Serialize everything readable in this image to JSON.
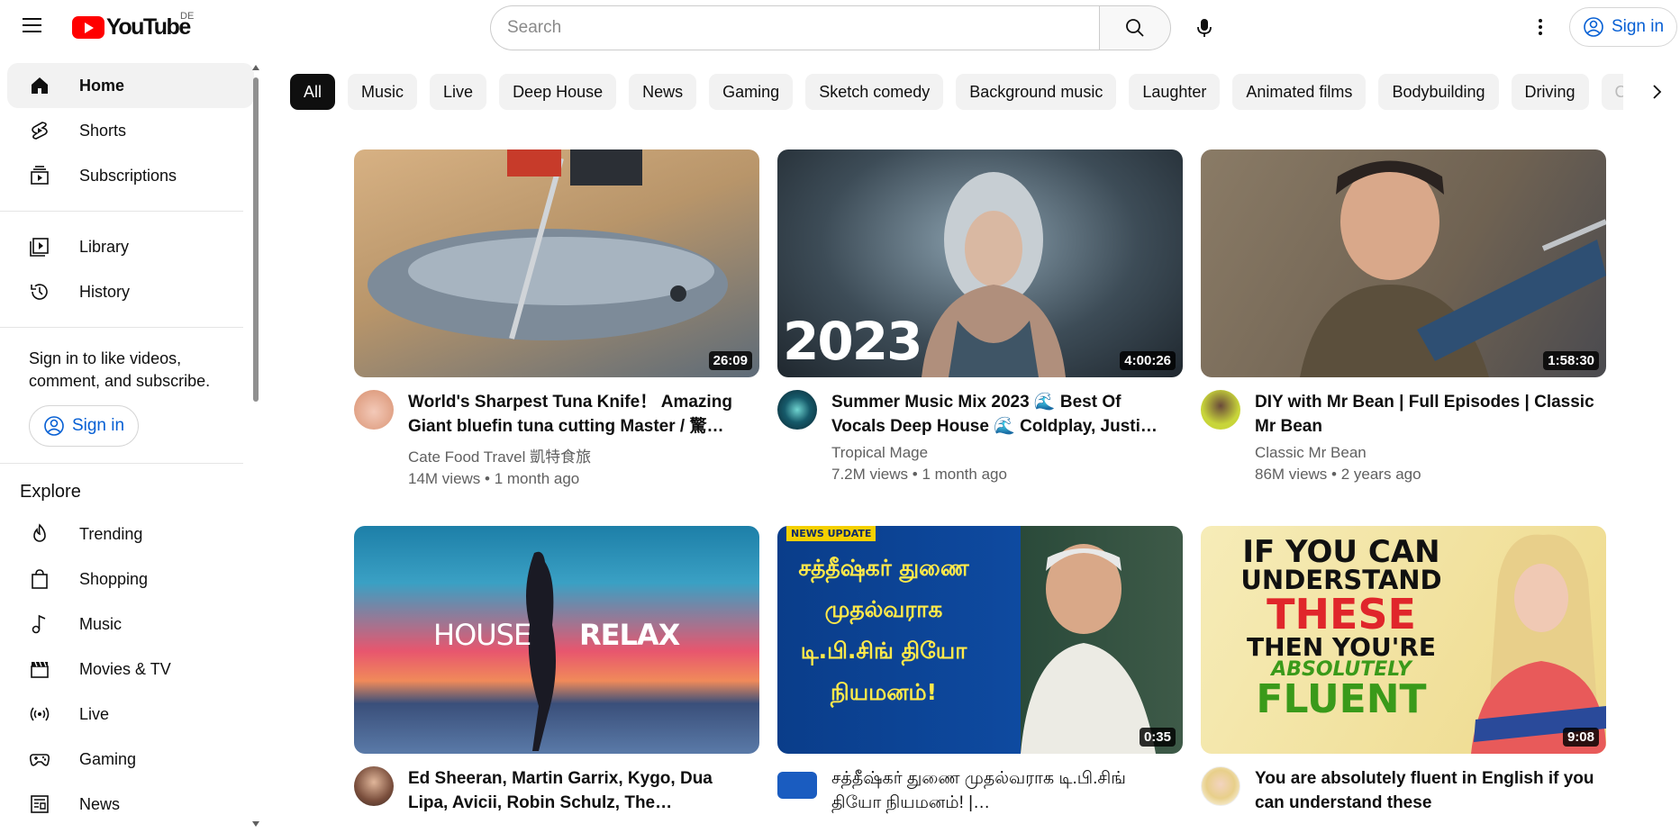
{
  "header": {
    "logo_text": "YouTube",
    "country": "DE",
    "search_placeholder": "Search",
    "signin_label": "Sign in"
  },
  "sidebar": {
    "primary": [
      {
        "label": "Home",
        "icon": "home-icon",
        "active": true
      },
      {
        "label": "Shorts",
        "icon": "shorts-icon"
      },
      {
        "label": "Subscriptions",
        "icon": "subscriptions-icon"
      }
    ],
    "library": [
      {
        "label": "Library",
        "icon": "library-icon"
      },
      {
        "label": "History",
        "icon": "history-icon"
      }
    ],
    "signin_prompt": "Sign in to like videos, comment, and subscribe.",
    "signin_label": "Sign in",
    "explore_title": "Explore",
    "explore": [
      {
        "label": "Trending",
        "icon": "trending-icon"
      },
      {
        "label": "Shopping",
        "icon": "shopping-icon"
      },
      {
        "label": "Music",
        "icon": "music-icon"
      },
      {
        "label": "Movies & TV",
        "icon": "movies-icon"
      },
      {
        "label": "Live",
        "icon": "live-icon"
      },
      {
        "label": "Gaming",
        "icon": "gaming-icon"
      },
      {
        "label": "News",
        "icon": "news-icon"
      }
    ]
  },
  "chips": [
    "All",
    "Music",
    "Live",
    "Deep House",
    "News",
    "Gaming",
    "Sketch comedy",
    "Background music",
    "Laughter",
    "Animated films",
    "Bodybuilding",
    "Driving",
    "Co"
  ],
  "videos": [
    {
      "title": "World's Sharpest Tuna Knife！ Amazing Giant bluefin tuna cutting Master / 驚…",
      "channel": "Cate Food Travel 凱特食旅",
      "views": "14M views",
      "age": "1 month ago",
      "duration": "26:09",
      "colors": [
        "#c9a47a",
        "#6e7f8f"
      ],
      "avatar_color": "#e8b7a8"
    },
    {
      "title": "Summer Music Mix 2023 🌊 Best Of Vocals Deep House 🌊 Coldplay, Justi…",
      "channel": "Tropical Mage",
      "views": "7.2M views",
      "age": "1 month ago",
      "duration": "4:00:26",
      "colors": [
        "#2f3b45",
        "#8a9aa6"
      ],
      "avatar_color": "#1d4b5a",
      "overlay": "2023"
    },
    {
      "title": "DIY with Mr Bean | Full Episodes | Classic Mr Bean",
      "channel": "Classic Mr Bean",
      "views": "86M views",
      "age": "2 years ago",
      "duration": "1:58:30",
      "colors": [
        "#7a6b58",
        "#3b4a5a"
      ],
      "avatar_color": "#c8d53a"
    },
    {
      "title": "Ed Sheeran, Martin Garrix, Kygo, Dua Lipa, Avicii, Robin Schulz, The…",
      "channel": "",
      "views": "",
      "age": "",
      "duration": "",
      "colors": [
        "#1f7fa6",
        "#e0506a"
      ],
      "avatar_color": "#8a5a4a",
      "overlay_left": "HOUSE",
      "overlay_right": "RELAX"
    },
    {
      "title": "சத்தீஷ்கர் துணை முதல்வராக டி.பி.சிங் தியோ நியமனம்! |…",
      "channel": "",
      "views": "",
      "age": "",
      "duration": "0:35",
      "colors": [
        "#0b3f8c",
        "#2a5a9e"
      ],
      "avatar_color": "#1a5cc0",
      "badge": "NEWS UPDATE",
      "overlay_tamil": "சத்தீஷ்கர் துணை முதல்வராக டி.பி.சிங் தியோ நியமனம்!"
    },
    {
      "title": "You are absolutely fluent in English if you can understand these",
      "channel": "",
      "views": "",
      "age": "",
      "duration": "9:08",
      "colors": [
        "#f3e3a0",
        "#e6c96a"
      ],
      "avatar_color": "#e8cfa0",
      "overlay_lines": [
        "IF YOU CAN",
        "UNDERSTAND",
        "THESE",
        "THEN YOU'RE",
        "ABSOLUTELY",
        "FLUENT"
      ]
    }
  ]
}
